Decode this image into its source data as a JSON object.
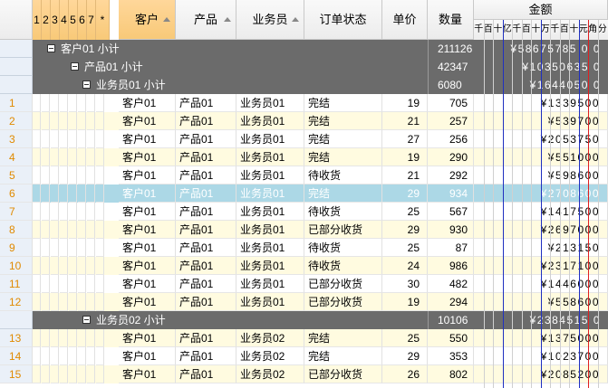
{
  "header": {
    "levels": [
      "1",
      "2",
      "3",
      "4",
      "5",
      "6",
      "7",
      "*"
    ],
    "columns": [
      "客户",
      "产品",
      "业务员",
      "订单状态",
      "单价",
      "数量"
    ],
    "amount_title": "金额",
    "amount_units": [
      "千",
      "百",
      "十",
      "亿",
      "千",
      "百",
      "十",
      "万",
      "千",
      "百",
      "十",
      "元",
      "角",
      "分"
    ]
  },
  "rows": [
    {
      "type": "sub",
      "num": "",
      "label": "客户01 小计",
      "indent": 1,
      "qty": "211126",
      "amount": "¥58675785 0 0"
    },
    {
      "type": "sub",
      "num": "",
      "label": "产品01 小计",
      "indent": 2,
      "qty": "42347",
      "amount": "¥10350635 0"
    },
    {
      "type": "sub",
      "num": "",
      "label": "业务员01 小计",
      "indent": 3,
      "qty": "6080",
      "amount": "¥1644050 0"
    },
    {
      "type": "data",
      "num": "1",
      "c": [
        "客户01",
        "产品01",
        "业务员01",
        "完结"
      ],
      "price": "19",
      "qty": "705",
      "amount": "¥1339500"
    },
    {
      "type": "data",
      "num": "2",
      "c": [
        "客户01",
        "产品01",
        "业务员01",
        "完结"
      ],
      "price": "21",
      "qty": "257",
      "amount": "¥539700"
    },
    {
      "type": "data",
      "num": "3",
      "c": [
        "客户01",
        "产品01",
        "业务员01",
        "完结"
      ],
      "price": "27",
      "qty": "256",
      "amount": "¥2053750"
    },
    {
      "type": "data",
      "num": "4",
      "c": [
        "客户01",
        "产品01",
        "业务员01",
        "完结"
      ],
      "price": "19",
      "qty": "290",
      "amount": "¥551000"
    },
    {
      "type": "data",
      "num": "5",
      "c": [
        "客户01",
        "产品01",
        "业务员01",
        "待收货"
      ],
      "price": "21",
      "qty": "292",
      "amount": "¥598600"
    },
    {
      "type": "selected",
      "num": "6",
      "c": [
        "客户01",
        "产品01",
        "业务员01",
        "完结"
      ],
      "price": "29",
      "qty": "934",
      "amount": "¥2708600"
    },
    {
      "type": "data",
      "num": "7",
      "c": [
        "客户01",
        "产品01",
        "业务员01",
        "待收货"
      ],
      "price": "25",
      "qty": "567",
      "amount": "¥1417500"
    },
    {
      "type": "data",
      "num": "8",
      "c": [
        "客户01",
        "产品01",
        "业务员01",
        "已部分收货"
      ],
      "price": "29",
      "qty": "930",
      "amount": "¥2697000"
    },
    {
      "type": "data",
      "num": "9",
      "c": [
        "客户01",
        "产品01",
        "业务员01",
        "待收货"
      ],
      "price": "25",
      "qty": "87",
      "amount": "¥213150"
    },
    {
      "type": "data",
      "num": "10",
      "c": [
        "客户01",
        "产品01",
        "业务员01",
        "待收货"
      ],
      "price": "24",
      "qty": "986",
      "amount": "¥2317100"
    },
    {
      "type": "data",
      "num": "11",
      "c": [
        "客户01",
        "产品01",
        "业务员01",
        "已部分收货"
      ],
      "price": "30",
      "qty": "482",
      "amount": "¥1446000"
    },
    {
      "type": "data",
      "num": "12",
      "c": [
        "客户01",
        "产品01",
        "业务员01",
        "已部分收货"
      ],
      "price": "19",
      "qty": "294",
      "amount": "¥558600"
    },
    {
      "type": "sub",
      "num": "",
      "label": "业务员02 小计",
      "indent": 3,
      "qty": "10106",
      "amount": "¥2384515 0"
    },
    {
      "type": "data",
      "num": "13",
      "c": [
        "客户01",
        "产品01",
        "业务员02",
        "完结"
      ],
      "price": "25",
      "qty": "550",
      "amount": "¥1375000"
    },
    {
      "type": "data",
      "num": "14",
      "c": [
        "客户01",
        "产品01",
        "业务员02",
        "完结"
      ],
      "price": "29",
      "qty": "353",
      "amount": "¥1023700"
    },
    {
      "type": "data",
      "num": "15",
      "c": [
        "客户01",
        "产品01",
        "业务员02",
        "已部分收货"
      ],
      "price": "26",
      "qty": "802",
      "amount": "¥2085200"
    }
  ],
  "colors": {
    "subtotal_bg": "#6b6b6b",
    "alt_row_bg": "#fffbe0",
    "selected_bg": "#acd8e6",
    "row_number": "#e08a00",
    "header_gold": "#f8c978"
  }
}
